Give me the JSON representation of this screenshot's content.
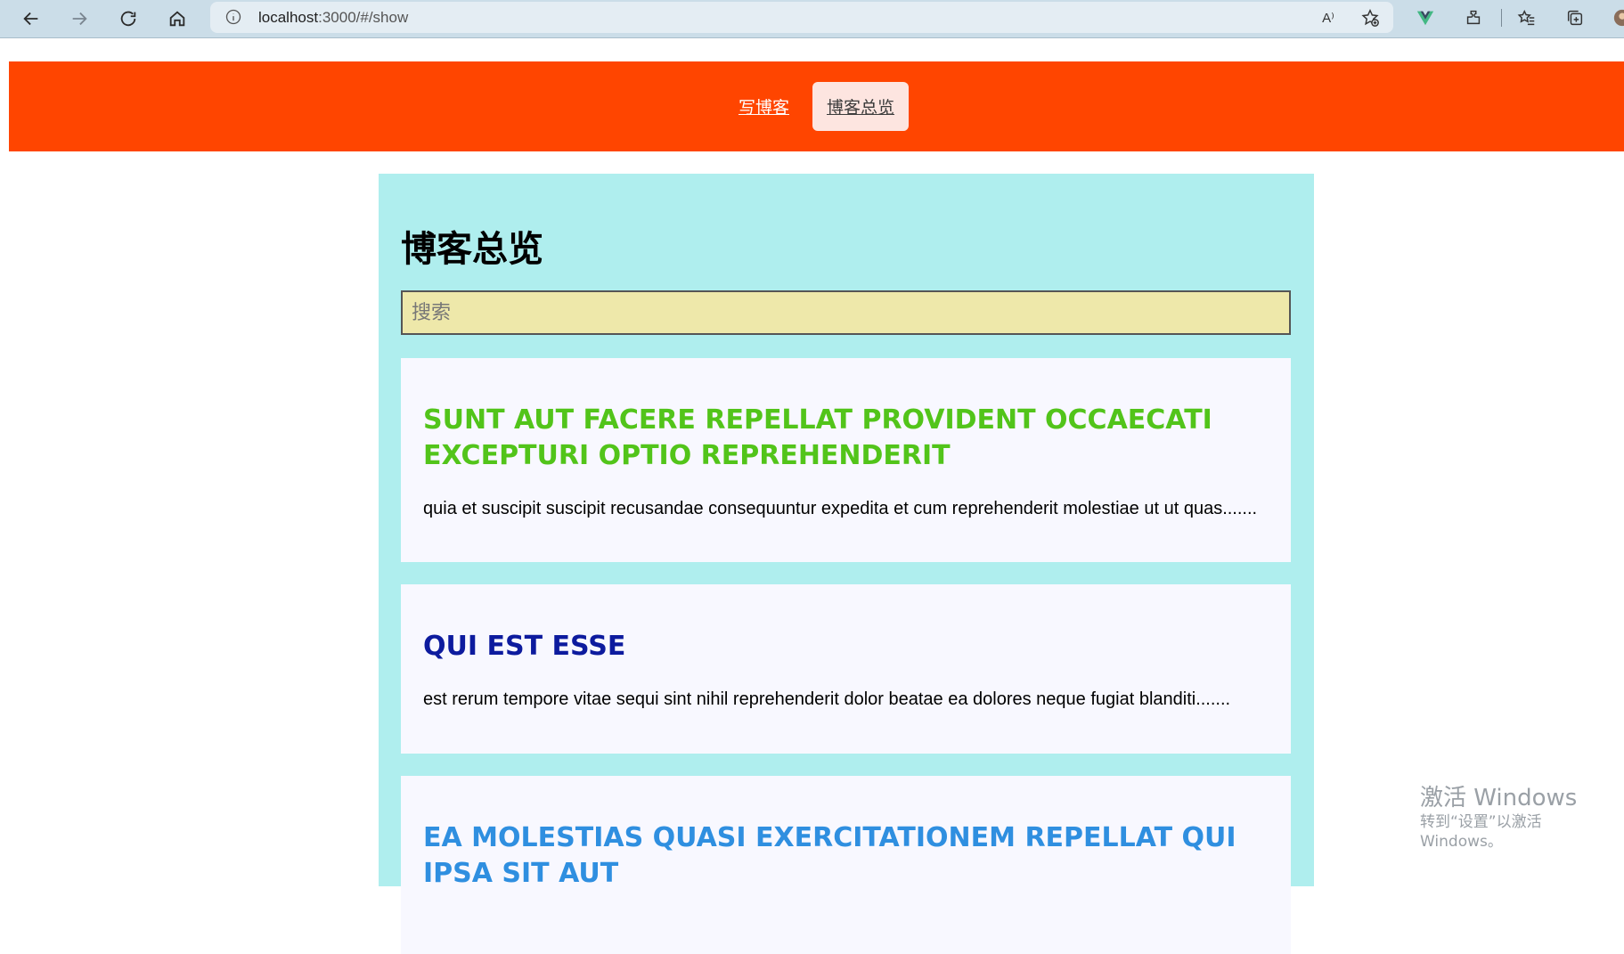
{
  "browser": {
    "url_host": "localhost",
    "url_rest": ":3000/#/show",
    "read_aloud_label": "A⁾"
  },
  "nav": {
    "write_label": "写博客",
    "overview_label": "博客总览"
  },
  "page": {
    "title": "博客总览",
    "search_placeholder": "搜索",
    "search_value": ""
  },
  "blogs": [
    {
      "title": "sunt aut facere repellat provident occaecati excepturi optio reprehenderit",
      "body": "quia et suscipit suscipit recusandae consequuntur expedita et cum reprehenderit molestiae ut ut quas.......",
      "color": "#52c41a"
    },
    {
      "title": "qui est esse",
      "body": "est rerum tempore vitae sequi sint nihil reprehenderit dolor beatae ea dolores neque fugiat blanditi.......",
      "color": "#0d1b9e"
    },
    {
      "title": "ea molestias quasi exercitationem repellat qui ipsa sit aut",
      "body": "",
      "color": "#2f8fe0"
    }
  ],
  "watermark": {
    "title": "激活 Windows",
    "subtitle": "转到“设置”以激活 Windows。"
  },
  "colors": {
    "header_bg": "#ff4500",
    "content_bg": "#afeeee",
    "search_bg": "#eee8aa",
    "card_bg": "#f8f8ff"
  }
}
